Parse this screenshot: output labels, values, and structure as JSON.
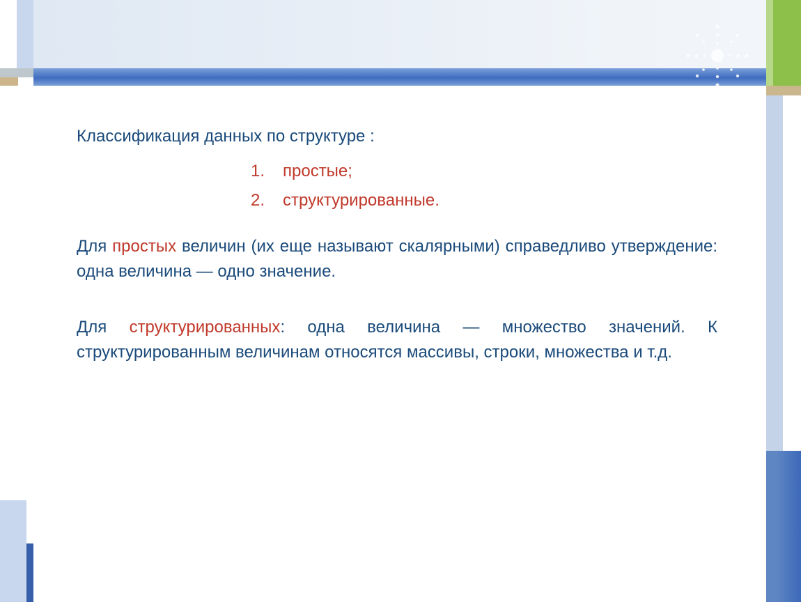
{
  "heading": "Классификация данных по структуре :",
  "list": [
    {
      "num": "1.",
      "text": "простые;"
    },
    {
      "num": "2.",
      "text": "структурированные."
    }
  ],
  "para1": {
    "start": "Для ",
    "red": "простых",
    "rest": " величин (их еще называют скалярными) справедливо утверждение: одна величина — одно значение."
  },
  "para2": {
    "start": "Для ",
    "red": "структурированных",
    "rest": ": одна величина — множество значений. К структурированным величинам относятся массивы, строки, множества и т.д."
  }
}
